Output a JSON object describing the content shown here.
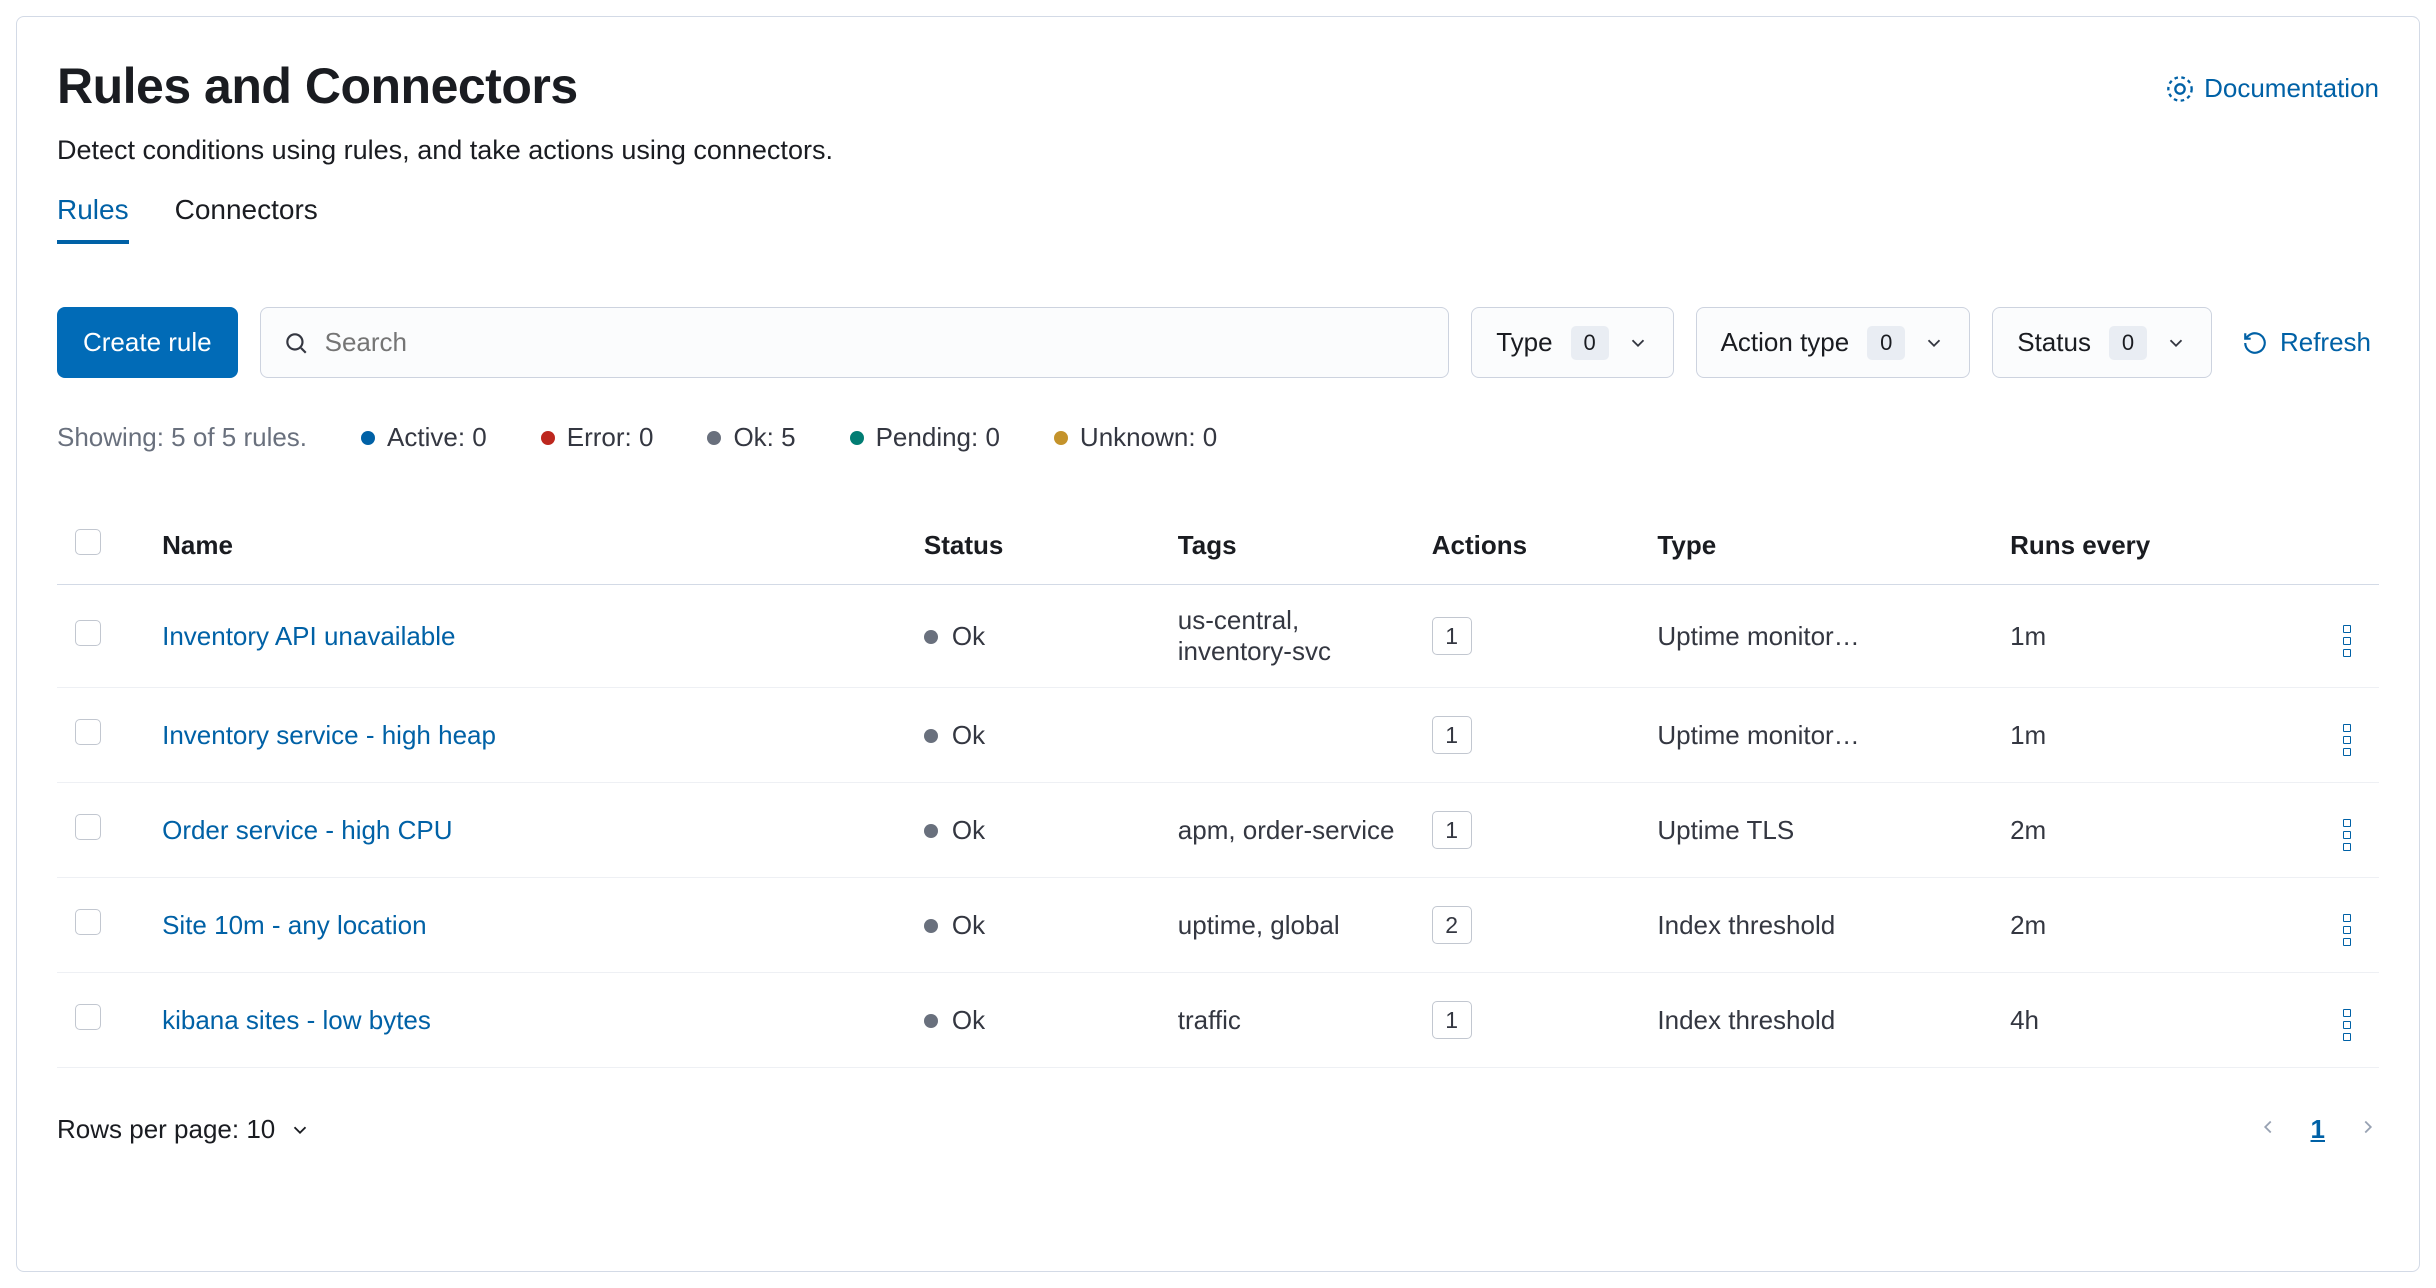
{
  "header": {
    "title": "Rules and Connectors",
    "subtitle": "Detect conditions using rules, and take actions using connectors.",
    "documentation_label": "Documentation"
  },
  "tabs": {
    "rules": "Rules",
    "connectors": "Connectors"
  },
  "toolbar": {
    "create_rule_label": "Create rule",
    "search_placeholder": "Search",
    "type_filter_label": "Type",
    "type_filter_count": "0",
    "action_type_filter_label": "Action type",
    "action_type_filter_count": "0",
    "status_filter_label": "Status",
    "status_filter_count": "0",
    "refresh_label": "Refresh"
  },
  "summary": {
    "showing": "Showing: 5 of 5 rules.",
    "active": "Active: 0",
    "error": "Error: 0",
    "ok": "Ok: 5",
    "pending": "Pending: 0",
    "unknown": "Unknown: 0"
  },
  "columns": {
    "name": "Name",
    "status": "Status",
    "tags": "Tags",
    "actions": "Actions",
    "type": "Type",
    "runs_every": "Runs every"
  },
  "rows": [
    {
      "name": "Inventory API unavailable",
      "status": "Ok",
      "tags": "us-central, inventory-svc",
      "actions": "1",
      "type": "Uptime monitor…",
      "runs_every": "1m"
    },
    {
      "name": "Inventory service - high heap",
      "status": "Ok",
      "tags": "",
      "actions": "1",
      "type": "Uptime monitor…",
      "runs_every": "1m"
    },
    {
      "name": "Order service - high CPU",
      "status": "Ok",
      "tags": "apm, order-service",
      "actions": "1",
      "type": "Uptime TLS",
      "runs_every": "2m"
    },
    {
      "name": "Site 10m - any location",
      "status": "Ok",
      "tags": "uptime, global",
      "actions": "2",
      "type": "Index threshold",
      "runs_every": "2m"
    },
    {
      "name": "kibana sites - low bytes",
      "status": "Ok",
      "tags": "traffic",
      "actions": "1",
      "type": "Index threshold",
      "runs_every": "4h"
    }
  ],
  "footer": {
    "rows_per_page_label": "Rows per page: 10",
    "current_page": "1"
  }
}
